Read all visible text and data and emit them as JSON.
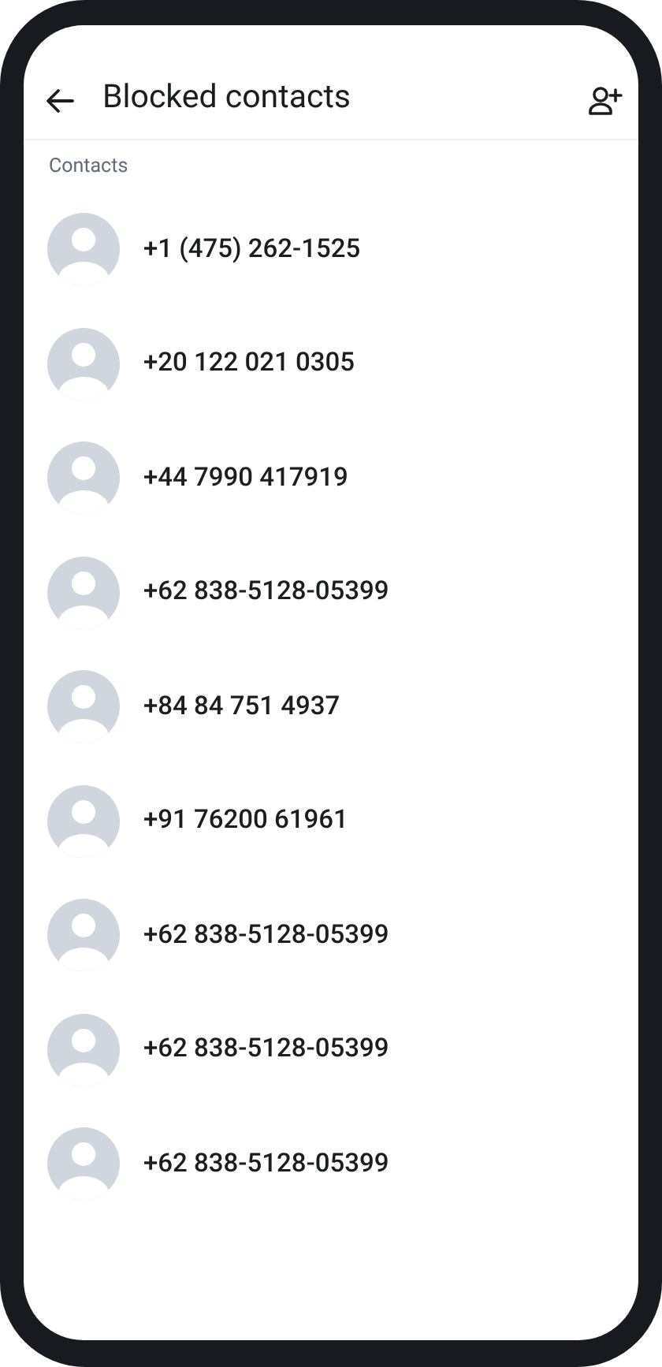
{
  "header": {
    "title": "Blocked contacts"
  },
  "section": {
    "label": "Contacts"
  },
  "contacts": [
    {
      "number": "+1 (475) 262-1525"
    },
    {
      "number": "+20 122 021 0305"
    },
    {
      "number": "+44 7990 417919"
    },
    {
      "number": "+62 838-5128-05399"
    },
    {
      "number": "+84 84 751 4937"
    },
    {
      "number": "+91 76200 61961"
    },
    {
      "number": "+62 838-5128-05399"
    },
    {
      "number": "+62 838-5128-05399"
    },
    {
      "number": "+62 838-5128-05399"
    }
  ]
}
